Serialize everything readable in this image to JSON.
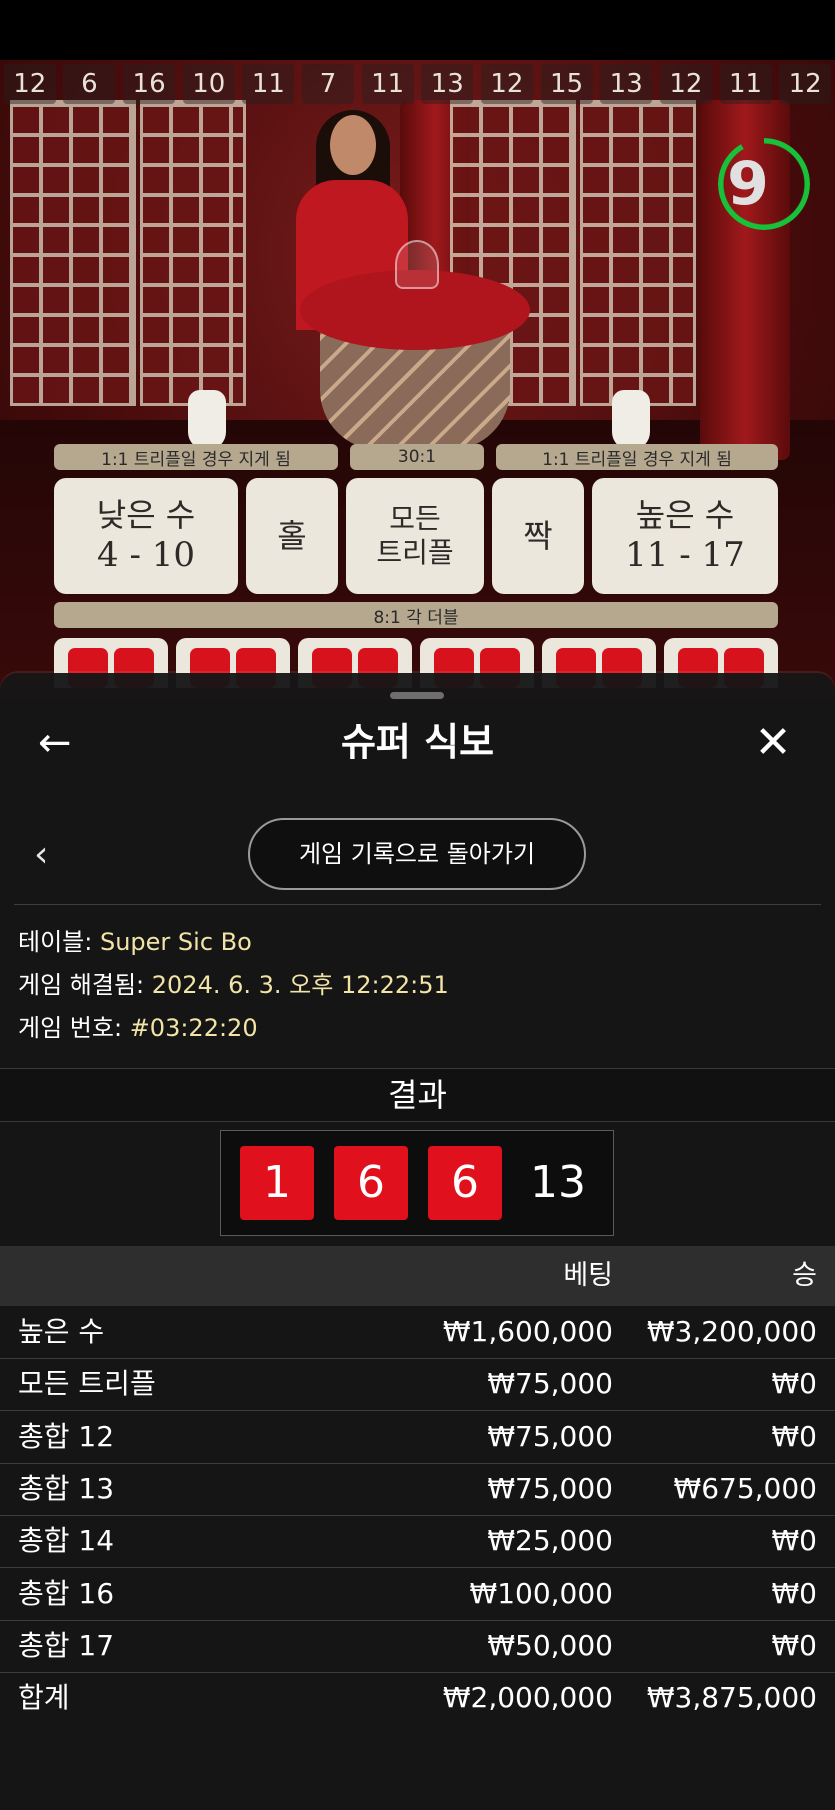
{
  "strip_numbers": [
    "12",
    "6",
    "16",
    "10",
    "11",
    "7",
    "11",
    "13",
    "12",
    "15",
    "13",
    "12",
    "11",
    "12"
  ],
  "timer": "9",
  "bet_labels": {
    "triple_lose_left": "1:1 트리플일 경우 지게 됨",
    "any_triple_odds": "30:1",
    "triple_lose_right": "1:1 트리플일 경우 지게 됨",
    "double_odds": "8:1 각 더블"
  },
  "bets": [
    {
      "main": "낮은 수",
      "sub": "4 - 10"
    },
    {
      "main": "홀",
      "sub": ""
    },
    {
      "main": "모든\n트리플",
      "sub": ""
    },
    {
      "main": "짝",
      "sub": ""
    },
    {
      "main": "높은 수",
      "sub": "11 - 17"
    }
  ],
  "panel": {
    "title": "슈퍼 식보",
    "back_icon": "arrow-left-icon",
    "close_icon": "close-icon",
    "history_button": "게임 기록으로 돌아가기"
  },
  "info": {
    "table_key": "테이블:",
    "table_value": "Super Sic Bo",
    "resolved_key": "게임 해결됨:",
    "resolved_value": "2024. 6. 3. 오후 12:22:51",
    "number_key": "게임 번호:",
    "number_value": "#03:22:20"
  },
  "result": {
    "heading": "결과",
    "dice": [
      "1",
      "6",
      "6"
    ],
    "total": "13",
    "die_color": "#e0101c"
  },
  "table": {
    "col_bet": "베팅",
    "col_win": "승",
    "rows": [
      {
        "name": "높은 수",
        "bet": "₩1,600,000",
        "win": "₩3,200,000"
      },
      {
        "name": "모든 트리플",
        "bet": "₩75,000",
        "win": "₩0"
      },
      {
        "name": "총합 12",
        "bet": "₩75,000",
        "win": "₩0"
      },
      {
        "name": "총합 13",
        "bet": "₩75,000",
        "win": "₩675,000"
      },
      {
        "name": "총합 14",
        "bet": "₩25,000",
        "win": "₩0"
      },
      {
        "name": "총합 16",
        "bet": "₩100,000",
        "win": "₩0"
      },
      {
        "name": "총합 17",
        "bet": "₩50,000",
        "win": "₩0"
      }
    ],
    "total_label": "합계",
    "total_bet": "₩2,000,000",
    "total_win": "₩3,875,000"
  },
  "colors": {
    "accent_value": "#f2e3a6",
    "timer_ring": "#18c13a"
  }
}
